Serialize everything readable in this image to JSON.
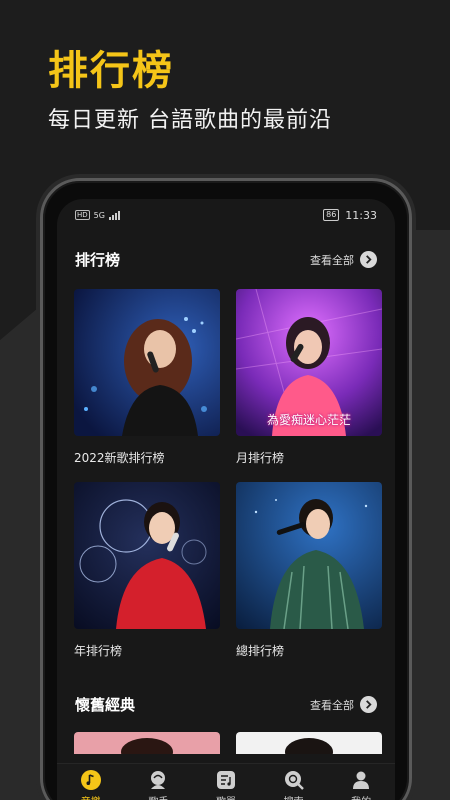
{
  "promo": {
    "title": "排行榜",
    "subtitle": "每日更新 台語歌曲的最前沿"
  },
  "status_bar": {
    "network": "HD",
    "network_sub": "5G",
    "battery": "86",
    "time": "11:33"
  },
  "sections": [
    {
      "title": "排行榜",
      "see_all": "查看全部",
      "cards": [
        {
          "label": "2022新歌排行榜"
        },
        {
          "label": "月排行榜",
          "overlay": "為愛痴迷心茫茫"
        },
        {
          "label": "年排行榜"
        },
        {
          "label": "總排行榜"
        }
      ]
    },
    {
      "title": "懷舊經典",
      "see_all": "查看全部"
    }
  ],
  "tabs": [
    {
      "label": "音樂",
      "icon": "music-note-icon",
      "active": true
    },
    {
      "label": "歌手",
      "icon": "singer-icon",
      "active": false
    },
    {
      "label": "歌單",
      "icon": "playlist-icon",
      "active": false
    },
    {
      "label": "搜索",
      "icon": "search-icon",
      "active": false
    },
    {
      "label": "我的",
      "icon": "profile-icon",
      "active": false
    }
  ],
  "colors": {
    "accent": "#f5c518",
    "background": "#1c1c1c",
    "screen": "#181818"
  }
}
